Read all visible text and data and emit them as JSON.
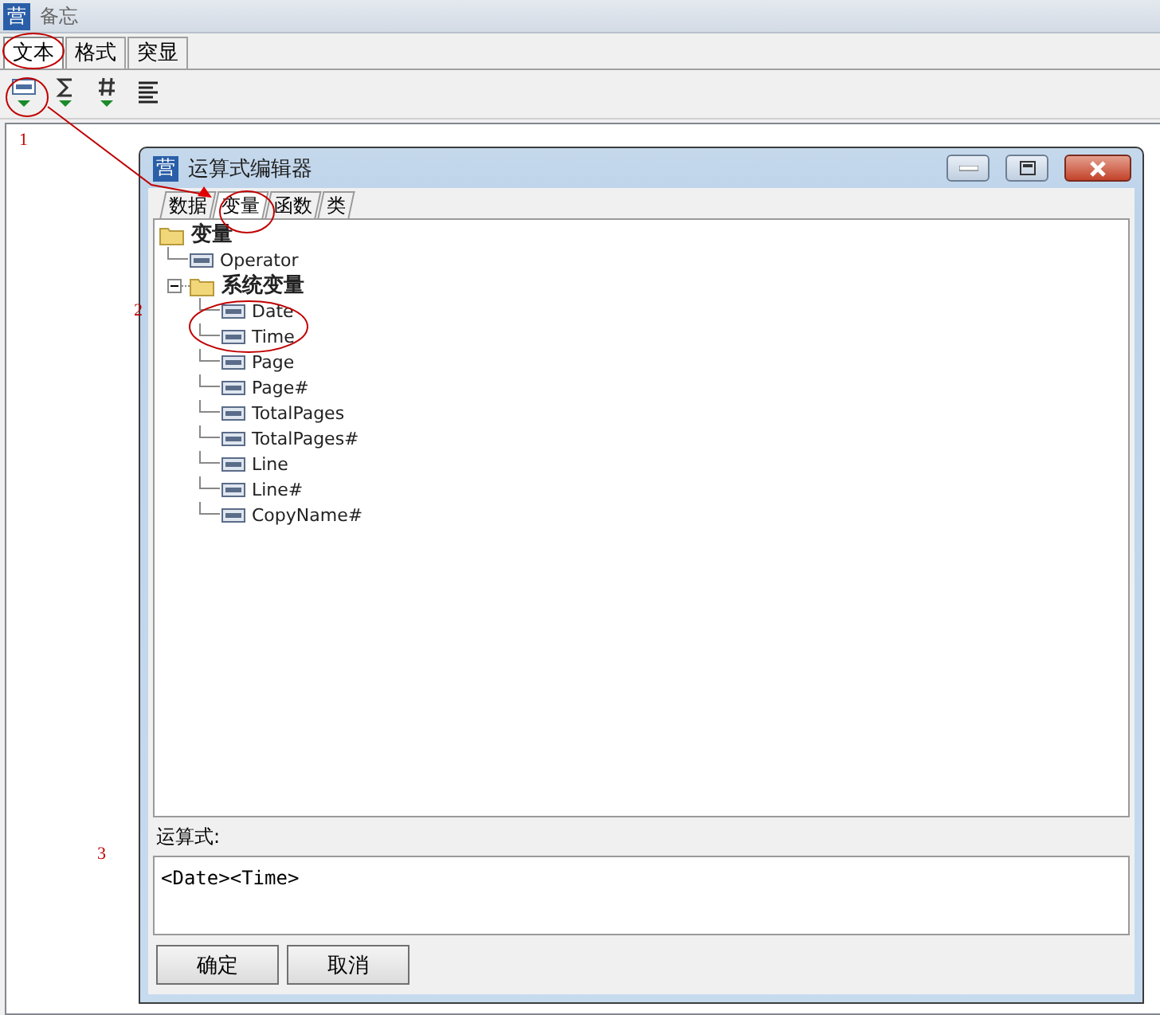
{
  "app": {
    "icon_text": "营",
    "title": "备忘",
    "tabs": [
      {
        "label": "文本",
        "selected": true
      },
      {
        "label": "格式",
        "selected": false
      },
      {
        "label": "突显",
        "selected": false
      }
    ],
    "toolbar": [
      {
        "kind": "text"
      },
      {
        "kind": "sum"
      },
      {
        "kind": "number"
      },
      {
        "kind": "align"
      }
    ]
  },
  "annotations": [
    {
      "label": "1"
    },
    {
      "label": "2"
    },
    {
      "label": "3"
    }
  ],
  "dialog": {
    "icon_text": "营",
    "title": "运算式编辑器",
    "tabs": [
      {
        "label": "数据",
        "selected": false
      },
      {
        "label": "变量",
        "selected": true
      },
      {
        "label": "函数",
        "selected": false
      },
      {
        "label": "类",
        "selected": false
      }
    ],
    "tree": [
      {
        "label": "变量",
        "kind": "folder",
        "children": [
          {
            "label": "Operator",
            "kind": "variable"
          },
          {
            "label": "系统变量",
            "kind": "folder",
            "children": [
              {
                "label": "Date",
                "kind": "variable"
              },
              {
                "label": "Time",
                "kind": "variable"
              },
              {
                "label": "Page",
                "kind": "variable"
              },
              {
                "label": "Page#",
                "kind": "variable"
              },
              {
                "label": "TotalPages",
                "kind": "variable"
              },
              {
                "label": "TotalPages#",
                "kind": "variable"
              },
              {
                "label": "Line",
                "kind": "variable"
              },
              {
                "label": "Line#",
                "kind": "variable"
              },
              {
                "label": "CopyName#",
                "kind": "variable"
              }
            ]
          }
        ]
      }
    ],
    "expression_label": "运算式:",
    "expression": "<Date><Time>",
    "buttons": [
      "确定",
      "取消"
    ]
  }
}
